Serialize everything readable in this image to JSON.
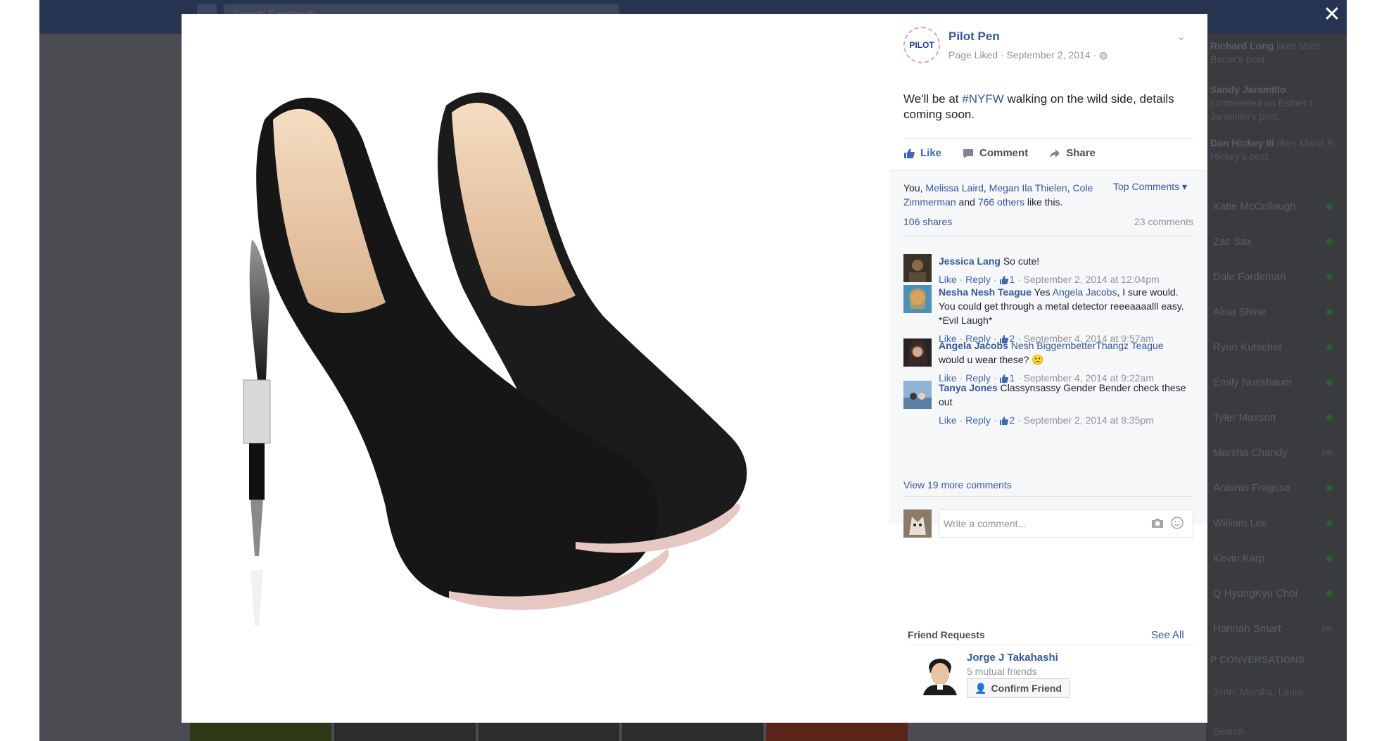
{
  "background": {
    "search_placeholder": "Search Facebook",
    "ticker": [
      {
        "name": "Richard Long",
        "text": " likes Marc Bauer's post."
      },
      {
        "name": "Sandy Jaramillo",
        "text": " commented on Esther L. Jaramillo's post."
      },
      {
        "name": "Dan Hickey III",
        "text": " likes Maria B. Hickey's post."
      }
    ],
    "chat": [
      {
        "name": "Katie McCollough",
        "status": "online"
      },
      {
        "name": "Zac Sax",
        "status": "online"
      },
      {
        "name": "Dale Fordeman",
        "status": "online"
      },
      {
        "name": "Alisa Shine",
        "status": "online"
      },
      {
        "name": "Ryan Kutscher",
        "status": "online"
      },
      {
        "name": "Emily Nussbaum",
        "status": "online"
      },
      {
        "name": "Tyler Maxson",
        "status": "online"
      },
      {
        "name": "Marsha Chandy",
        "status": "mobile",
        "mobile_label": "1m"
      },
      {
        "name": "Antonio Fragoso",
        "status": "online"
      },
      {
        "name": "William Lee",
        "status": "online"
      },
      {
        "name": "Kevin Karp",
        "status": "online"
      },
      {
        "name": "Q HyungKyu Choi",
        "status": "online"
      },
      {
        "name": "Hannah Smart",
        "status": "mobile",
        "mobile_label": "1m"
      }
    ],
    "conversations_heading": "P CONVERSATIONS",
    "conversation": "Jenn, Marsha, Laura",
    "chat_search": "Search"
  },
  "close_label": "✕",
  "post": {
    "page_logo": "PILOT",
    "page_name": "Pilot Pen",
    "meta": "Page Liked · September 2, 2014 ·",
    "text_before": "We'll be at ",
    "hashtag": "#NYFW",
    "text_after": " walking on the wild side, details coming soon.",
    "actions": {
      "like": "Like",
      "comment": "Comment",
      "share": "Share"
    },
    "likes_prefix": "You, ",
    "likers": [
      "Melissa Laird",
      "Megan Ila Thielen",
      "Cole Zimmerman"
    ],
    "others": "766 others",
    "likes_suffix": " like this.",
    "top_comments": "Top Comments ▾",
    "shares": "106 shares",
    "comments_count": "23 comments"
  },
  "comments": [
    {
      "author": "Jessica Lang",
      "mention": "",
      "text": " So cute!",
      "likes": "1",
      "time": "September 2, 2014 at 12:04pm"
    },
    {
      "author": "Nesha Nesh Teague",
      "text_pre": " Yes ",
      "mention": "Angela Jacobs",
      "text": ", I sure would. You could get through a metal detector reeeaaaalll easy. *Evil Laugh*",
      "likes": "2",
      "time": "September 4, 2014 at 9:57am"
    },
    {
      "author": "Angela Jacobs",
      "text_pre": " ",
      "mention": "Nesh BiggernbetterThangz Teague",
      "text": " would u wear these? 🙁",
      "likes": "1",
      "time": "September 4, 2014 at 9:22am"
    },
    {
      "author": "Tanya Jones",
      "mention": "",
      "text": " Classynsassy Gender Bender check these out",
      "likes": "2",
      "time": "September 2, 2014 at 8:35pm"
    }
  ],
  "comment_actions": {
    "like": "Like",
    "reply": "Reply"
  },
  "view_more": "View 19 more comments",
  "write_placeholder": "Write a comment...",
  "friend_requests": {
    "title": "Friend Requests",
    "see_all": "See All",
    "name": "Jorge J Takahashi",
    "mutual": "5 mutual friends",
    "confirm": "Confirm Friend"
  }
}
